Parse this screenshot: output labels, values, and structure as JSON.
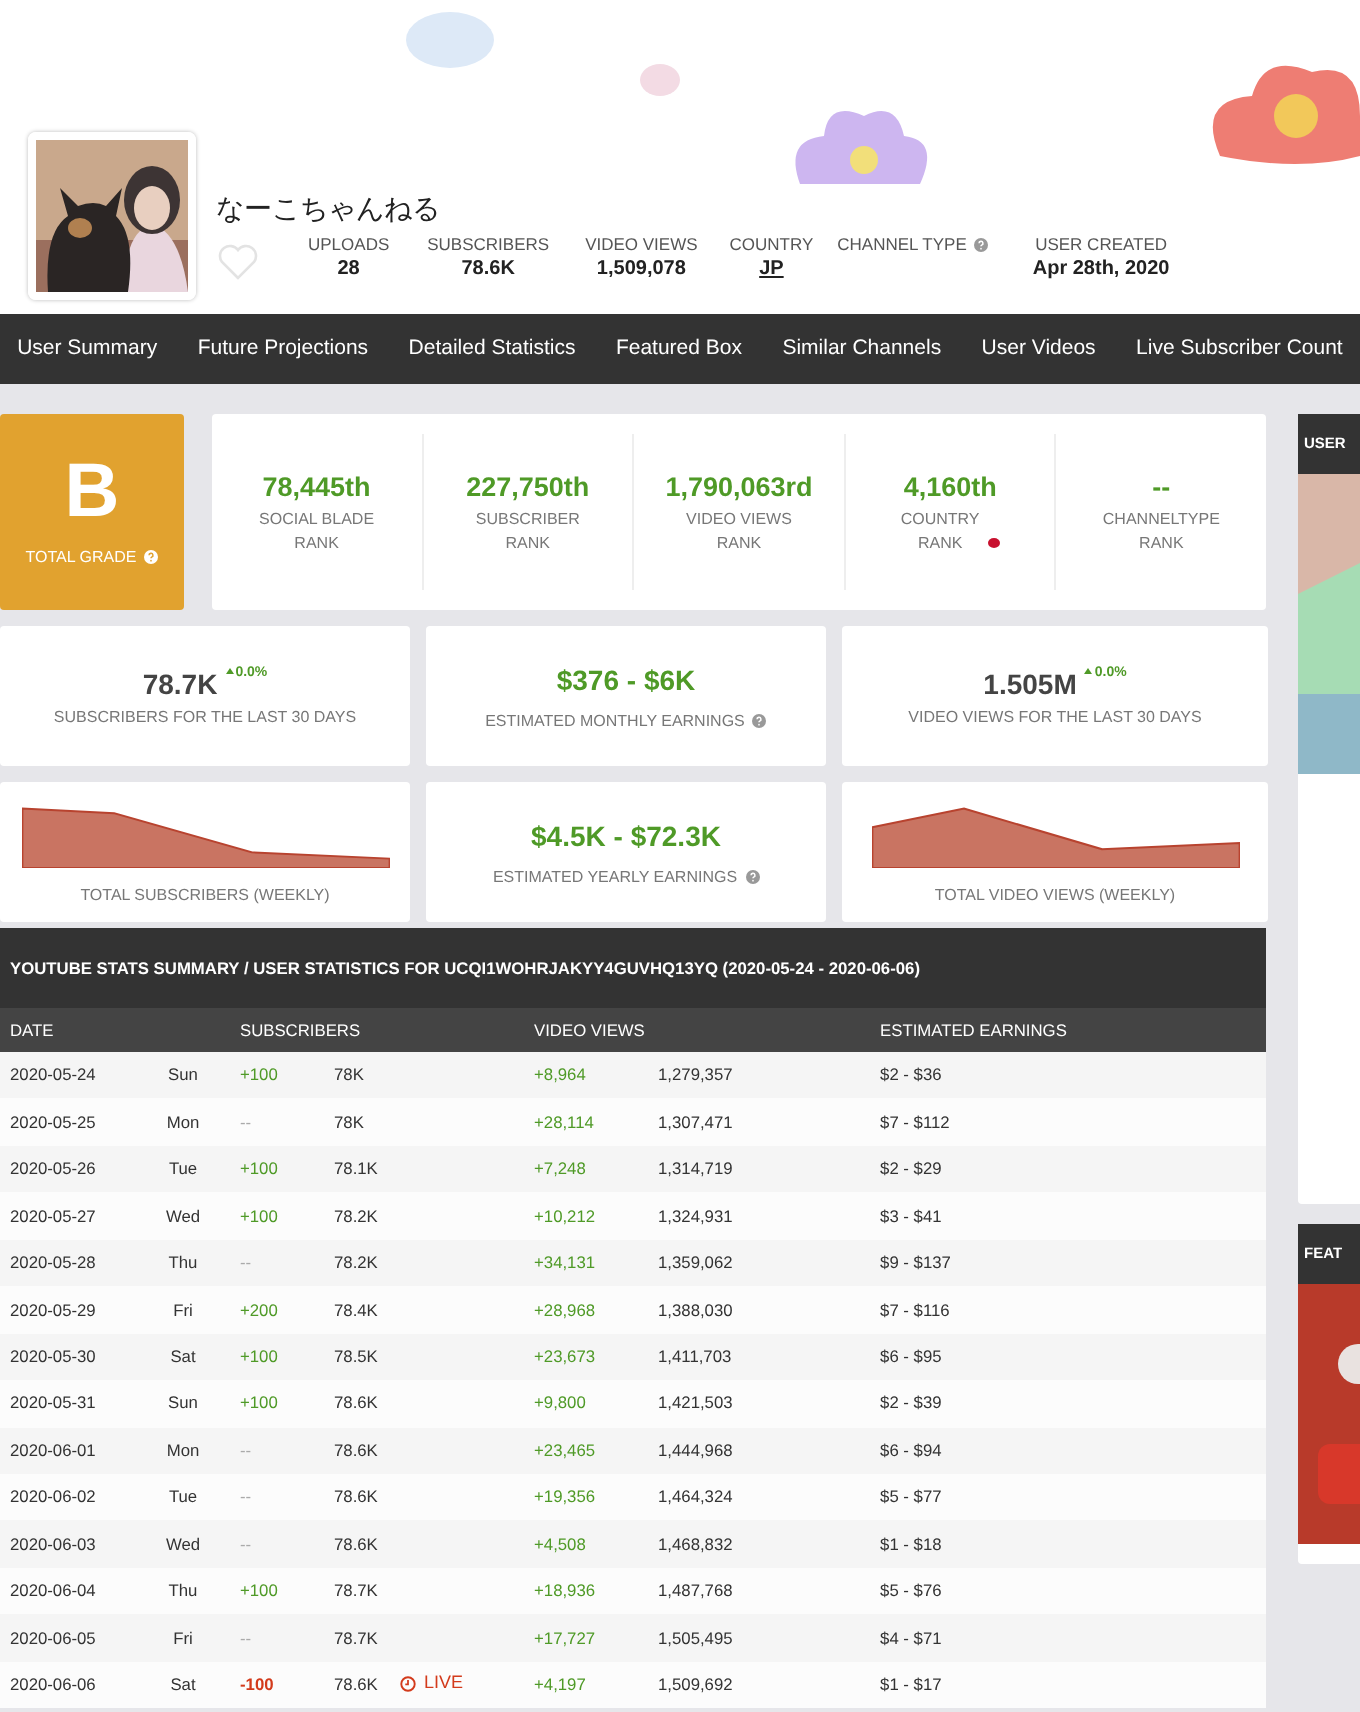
{
  "channel": {
    "name": "なーこちゃんねる",
    "stats": [
      {
        "label": "UPLOADS",
        "value": "28",
        "kind": "plain"
      },
      {
        "label": "SUBSCRIBERS",
        "value": "78.6K",
        "kind": "plain"
      },
      {
        "label": "VIDEO VIEWS",
        "value": "1,509,078",
        "kind": "plain"
      },
      {
        "label": "COUNTRY",
        "value": "JP",
        "kind": "link"
      },
      {
        "label": "CHANNEL TYPE",
        "kind": "help"
      },
      {
        "label": "USER CREATED",
        "value": "Apr 28th, 2020",
        "kind": "plain"
      }
    ]
  },
  "nav": [
    "User Summary",
    "Future Projections",
    "Detailed Statistics",
    "Featured Box",
    "Similar Channels",
    "User Videos",
    "Live Subscriber Count"
  ],
  "grade": {
    "letter": "B",
    "label": "TOTAL GRADE"
  },
  "ranks": [
    {
      "value": "78,445th",
      "label_lines": [
        "SOCIAL BLADE",
        "RANK"
      ]
    },
    {
      "value": "227,750th",
      "label_lines": [
        "SUBSCRIBER",
        "RANK"
      ]
    },
    {
      "value": "1,790,063rd",
      "label_lines": [
        "VIDEO VIEWS",
        "RANK"
      ]
    },
    {
      "value": "4,160th",
      "label_lines": [
        "COUNTRY",
        "RANK"
      ],
      "flag": true
    },
    {
      "value": "--",
      "label_lines": [
        "CHANNELTYPE",
        "RANK"
      ]
    }
  ],
  "cards": [
    {
      "kind": "stat",
      "value": "78.7K",
      "change": "0.0%",
      "label": "SUBSCRIBERS FOR THE LAST 30 DAYS"
    },
    {
      "kind": "earnings",
      "value": "$376 - $6K",
      "label": "ESTIMATED MONTHLY EARNINGS"
    },
    {
      "kind": "stat",
      "value": "1.505M",
      "change": "0.0%",
      "label": "VIDEO VIEWS FOR THE LAST 30 DAYS"
    },
    {
      "kind": "sparkline",
      "label": "TOTAL SUBSCRIBERS (WEEKLY)"
    },
    {
      "kind": "earnings",
      "value": "$4.5K - $72.3K",
      "label": "ESTIMATED YEARLY EARNINGS"
    },
    {
      "kind": "sparkline",
      "label": "TOTAL VIDEO VIEWS (WEEKLY)"
    }
  ],
  "table": {
    "title": "YOUTUBE STATS SUMMARY / USER STATISTICS FOR UCQI1WOHRJAKYY4GUVHQ13YQ (2020-05-24 - 2020-06-06)",
    "columns": [
      "DATE",
      "SUBSCRIBERS",
      "VIDEO VIEWS",
      "ESTIMATED EARNINGS"
    ],
    "rows": [
      {
        "date": "2020-05-24",
        "day": "Sun",
        "sub_change": "+100",
        "color": "#4f9a27",
        "subs": "78K",
        "views_change": "+8,964",
        "views": "1,279,357",
        "earnings": "$2 - $36"
      },
      {
        "date": "2020-05-25",
        "day": "Mon",
        "sub_change": "--",
        "color": "#aaaaaa",
        "subs": "78K",
        "views_change": "+28,114",
        "views": "1,307,471",
        "earnings": "$7 - $112"
      },
      {
        "date": "2020-05-26",
        "day": "Tue",
        "sub_change": "+100",
        "color": "#4f9a27",
        "subs": "78.1K",
        "views_change": "+7,248",
        "views": "1,314,719",
        "earnings": "$2 - $29"
      },
      {
        "date": "2020-05-27",
        "day": "Wed",
        "sub_change": "+100",
        "color": "#4f9a27",
        "subs": "78.2K",
        "views_change": "+10,212",
        "views": "1,324,931",
        "earnings": "$3 - $41"
      },
      {
        "date": "2020-05-28",
        "day": "Thu",
        "sub_change": "--",
        "color": "#aaaaaa",
        "subs": "78.2K",
        "views_change": "+34,131",
        "views": "1,359,062",
        "earnings": "$9 - $137"
      },
      {
        "date": "2020-05-29",
        "day": "Fri",
        "sub_change": "+200",
        "color": "#4f9a27",
        "subs": "78.4K",
        "views_change": "+28,968",
        "views": "1,388,030",
        "earnings": "$7 - $116"
      },
      {
        "date": "2020-05-30",
        "day": "Sat",
        "sub_change": "+100",
        "color": "#4f9a27",
        "subs": "78.5K",
        "views_change": "+23,673",
        "views": "1,411,703",
        "earnings": "$6 - $95"
      },
      {
        "date": "2020-05-31",
        "day": "Sun",
        "sub_change": "+100",
        "color": "#4f9a27",
        "subs": "78.6K",
        "views_change": "+9,800",
        "views": "1,421,503",
        "earnings": "$2 - $39"
      },
      {
        "date": "2020-06-01",
        "day": "Mon",
        "sub_change": "--",
        "color": "#aaaaaa",
        "subs": "78.6K",
        "views_change": "+23,465",
        "views": "1,444,968",
        "earnings": "$6 - $94"
      },
      {
        "date": "2020-06-02",
        "day": "Tue",
        "sub_change": "--",
        "color": "#aaaaaa",
        "subs": "78.6K",
        "views_change": "+19,356",
        "views": "1,464,324",
        "earnings": "$5 - $77"
      },
      {
        "date": "2020-06-03",
        "day": "Wed",
        "sub_change": "--",
        "color": "#aaaaaa",
        "subs": "78.6K",
        "views_change": "+4,508",
        "views": "1,468,832",
        "earnings": "$1 - $18"
      },
      {
        "date": "2020-06-04",
        "day": "Thu",
        "sub_change": "+100",
        "color": "#4f9a27",
        "subs": "78.7K",
        "views_change": "+18,936",
        "views": "1,487,768",
        "earnings": "$5 - $76"
      },
      {
        "date": "2020-06-05",
        "day": "Fri",
        "sub_change": "--",
        "color": "#aaaaaa",
        "subs": "78.7K",
        "views_change": "+17,727",
        "views": "1,505,495",
        "earnings": "$4 - $71"
      },
      {
        "date": "2020-06-06",
        "day": "Sat",
        "sub_change": "-100",
        "color": "#d33b1c",
        "subs": "78.6K",
        "live": "LIVE",
        "views_change": "+4,197",
        "views": "1,509,692",
        "earnings": "$1 - $17"
      }
    ]
  },
  "sidebar": [
    {
      "title": "USER"
    },
    {
      "title": "FEAT"
    }
  ]
}
